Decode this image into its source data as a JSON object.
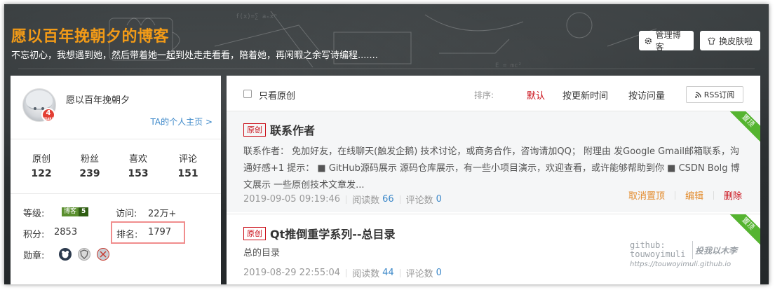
{
  "header": {
    "blog_title": "愿以百年挽朝夕的博客",
    "blog_desc": "不忘初心，我想遇到她，然后带着她一起到处走走看看，陪着她，再闲暇之余写诗编程.......",
    "manage_label": "管理博客",
    "skin_label": "换皮肤啦"
  },
  "profile": {
    "name": "愿以百年挽朝夕",
    "years": "4",
    "years_unit": "YEARS",
    "home_link": "TA的个人主页 >",
    "stats": [
      {
        "label": "原创",
        "value": "122"
      },
      {
        "label": "粉丝",
        "value": "239"
      },
      {
        "label": "喜欢",
        "value": "153"
      },
      {
        "label": "评论",
        "value": "151"
      }
    ],
    "level_label": "等级:",
    "level_badge_text": "博客",
    "level_badge_num": "5",
    "visit_label": "访问:",
    "visit_value": "22万+",
    "score_label": "积分:",
    "score_value": "2853",
    "rank_label": "排名:",
    "rank_value": "1797",
    "medal_label": "勋章:"
  },
  "filter": {
    "only_original": "只看原创",
    "sort_label": "排序:",
    "sort_default": "默认",
    "sort_update": "按更新时间",
    "sort_visits": "按访问量",
    "rss": "RSS订阅"
  },
  "posts": [
    {
      "tag": "原创",
      "pinned": "置顶",
      "title": "联系作者",
      "body": "联系作者： 免加好友，在线聊天(触发企鹅) 技术讨论，或商务合作，咨询请加QQ； 附理由 发Google Gmail邮箱联系，沟通好感+1 提示： ■ GitHub源码展示 源码仓库展示，有一些小项目演示，欢迎查看，或许能够帮助到你 ■ CSDN Bolg 博文展示 一些原创技术文章发...",
      "date": "2019-09-05 09:19:46",
      "read_label": "阅读数",
      "read": "66",
      "comment_label": "评论数",
      "comments": "0",
      "op_unpin": "取消置顶",
      "op_edit": "编辑",
      "op_delete": "删除"
    },
    {
      "tag": "原创",
      "pinned": "置顶",
      "title": "Qt推倒重学系列--总目录",
      "body": "总的目录",
      "date": "2019-08-29 22:55:04",
      "read_label": "阅读数",
      "read": "44",
      "comment_label": "评论数",
      "comments": "0"
    }
  ],
  "watermark": {
    "line1": "github:",
    "line2": "touwoyimuli",
    "sign": "投我以木李",
    "url": "https://touwoyimuli.github.io"
  },
  "colors": {
    "title_orange": "#f39b17",
    "tag_red": "#ca0c16",
    "link_blue": "#3c88c9",
    "pin_green": "#55b430",
    "op_orange": "#e38b2c",
    "rank_highlight": "#f08d8d"
  }
}
